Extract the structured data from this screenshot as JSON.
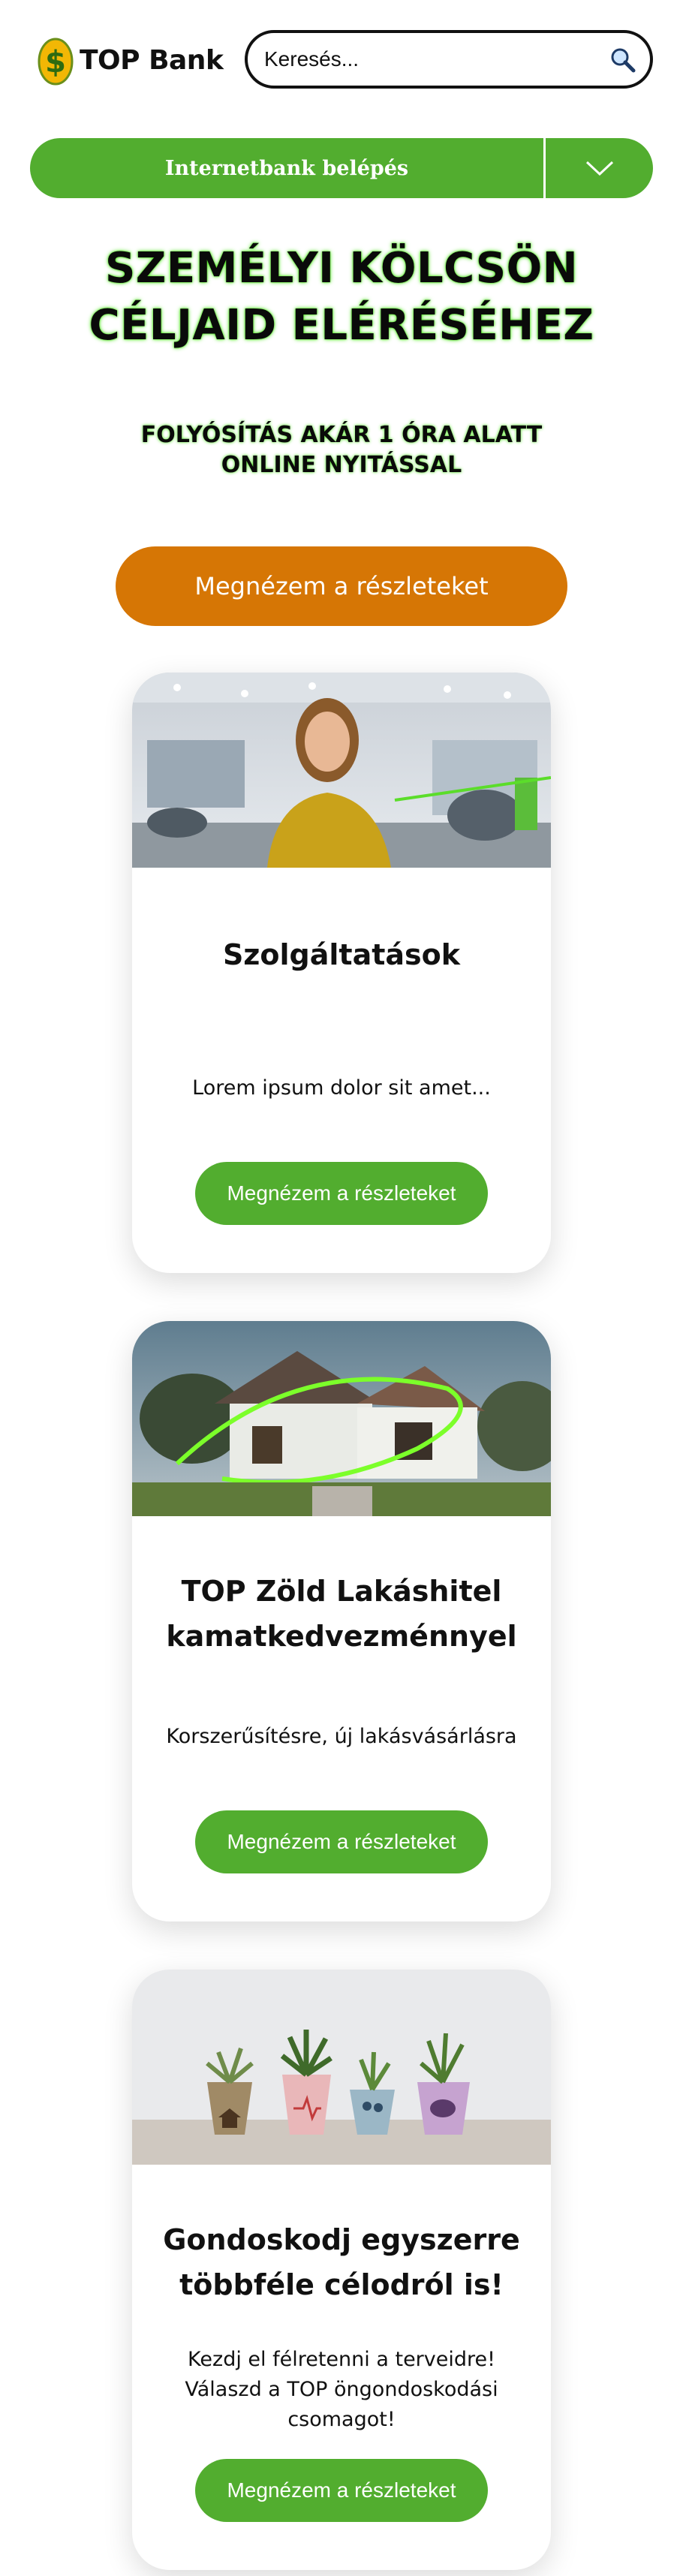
{
  "header": {
    "logo_text": "TOP Bank",
    "logo_icon": "dollar-coin-icon",
    "search": {
      "placeholder": "Keresés...",
      "value": "",
      "icon": "search-icon"
    }
  },
  "netbank": {
    "label": "Internetbank belépés",
    "toggle_icon": "chevron-down-icon"
  },
  "hero": {
    "title_line1": "SZEMÉLYI KÖLCSÖN",
    "title_line2": "CÉLJAID ELÉRÉSÉHEZ",
    "subtitle_line1": "FOLYÓSÍTÁS AKÁR 1 ÓRA ALATT",
    "subtitle_line2": "ONLINE NYITÁSSAL",
    "cta_label": "Megnézem a részleteket"
  },
  "cards": [
    {
      "title": "Szolgáltatások",
      "text": "Lorem ipsum dolor sit amet...",
      "button_label": "Megnézem a részleteket"
    },
    {
      "title_line1": "TOP Zöld Lakáshitel",
      "title_line2": "kamatkedvezménnyel",
      "text": "Korszerűsítésre, új lakásvásárlásra",
      "button_label": "Megnézem a részleteket"
    },
    {
      "title_line1": "Gondoskodj egyszerre",
      "title_line2": "többféle célodról is!",
      "text_line1": "Kezdj el félretenni a terveidre!",
      "text_line2": "Válaszd a TOP öngondoskodási",
      "text_line3": "csomagot!",
      "button_label": "Megnézem a részleteket"
    }
  ],
  "colors": {
    "brand_green": "#52ad2f",
    "cta_orange": "#d67605",
    "glow_green": "#4be21a"
  }
}
